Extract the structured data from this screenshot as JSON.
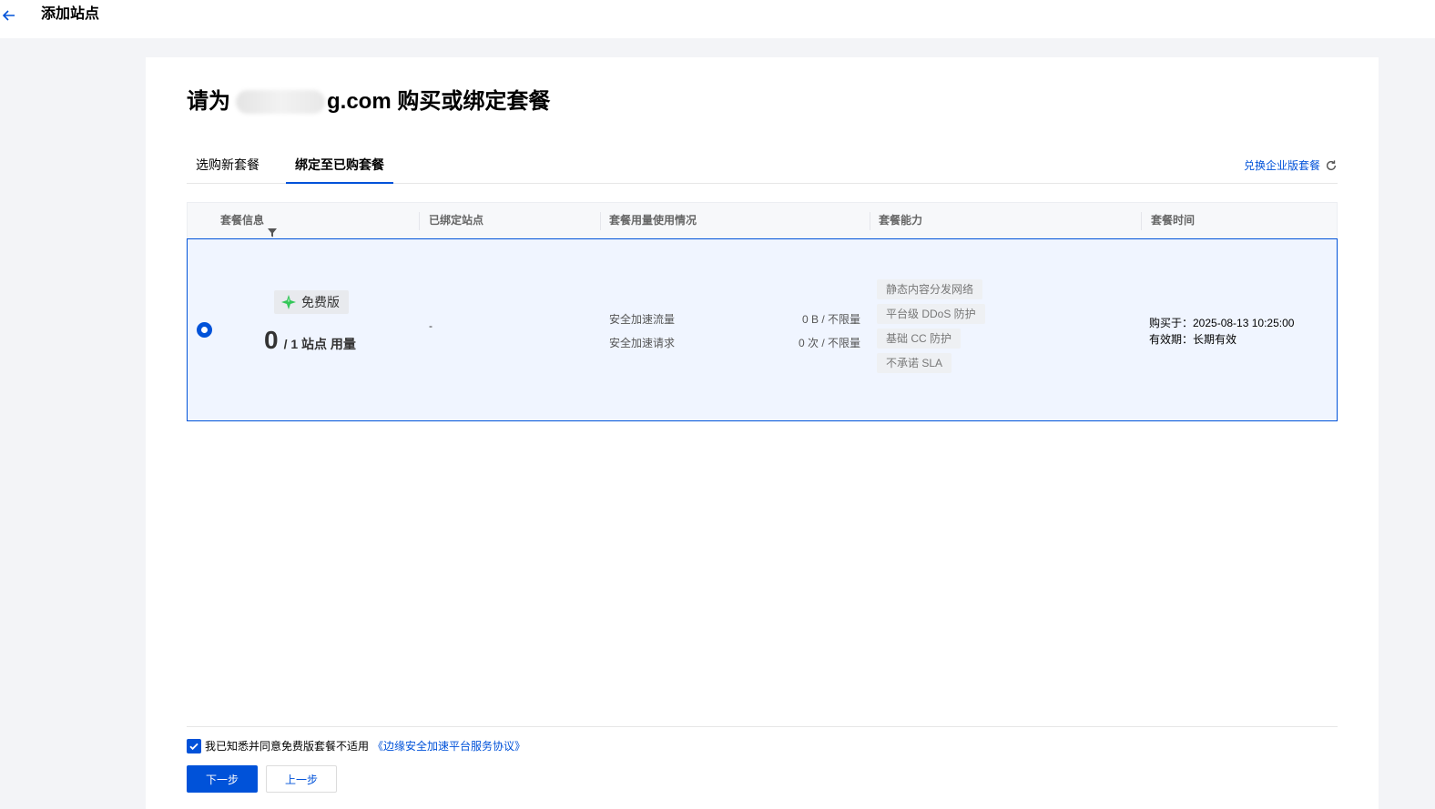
{
  "header": {
    "title": "添加站点",
    "back_icon": "arrow-left-icon"
  },
  "page": {
    "title_prefix": "请为",
    "title_suffix": "g.com 购买或绑定套餐"
  },
  "tabs": [
    {
      "label": "选购新套餐",
      "active": false
    },
    {
      "label": "绑定至已购套餐",
      "active": true
    }
  ],
  "redeem_link": {
    "label": "兑换企业版套餐",
    "icon": "refresh-icon"
  },
  "table": {
    "columns": [
      "套餐信息",
      "已绑定站点",
      "套餐用量使用情况",
      "套餐能力",
      "套餐时间"
    ],
    "rows": [
      {
        "selected": true,
        "plan_name": "免费版",
        "plan_icon": "sparkle-icon",
        "usage_used": "0",
        "usage_total": "/ 1 站点 用量",
        "bound_sites": "-",
        "quotas": [
          {
            "label": "安全加速流量",
            "value": "0 B / 不限量"
          },
          {
            "label": "安全加速请求",
            "value": "0 次 / 不限量"
          }
        ],
        "capabilities": [
          "静态内容分发网络",
          "平台级 DDoS 防护",
          "基础 CC 防护",
          "不承诺 SLA"
        ],
        "purchased_at": "购买于：2025-08-13 10:25:00",
        "validity": "有效期：长期有效"
      }
    ]
  },
  "footer": {
    "agree_checked": true,
    "agree_text": "我已知悉并同意免费版套餐不适用",
    "agree_link": "《边缘安全加速平台服务协议》",
    "next_button": "下一步",
    "prev_button": "上一步"
  },
  "colors": {
    "accent": "#0052d9",
    "selected_row_bg": "#f0f5ff",
    "page_bg": "#f3f4f7"
  }
}
